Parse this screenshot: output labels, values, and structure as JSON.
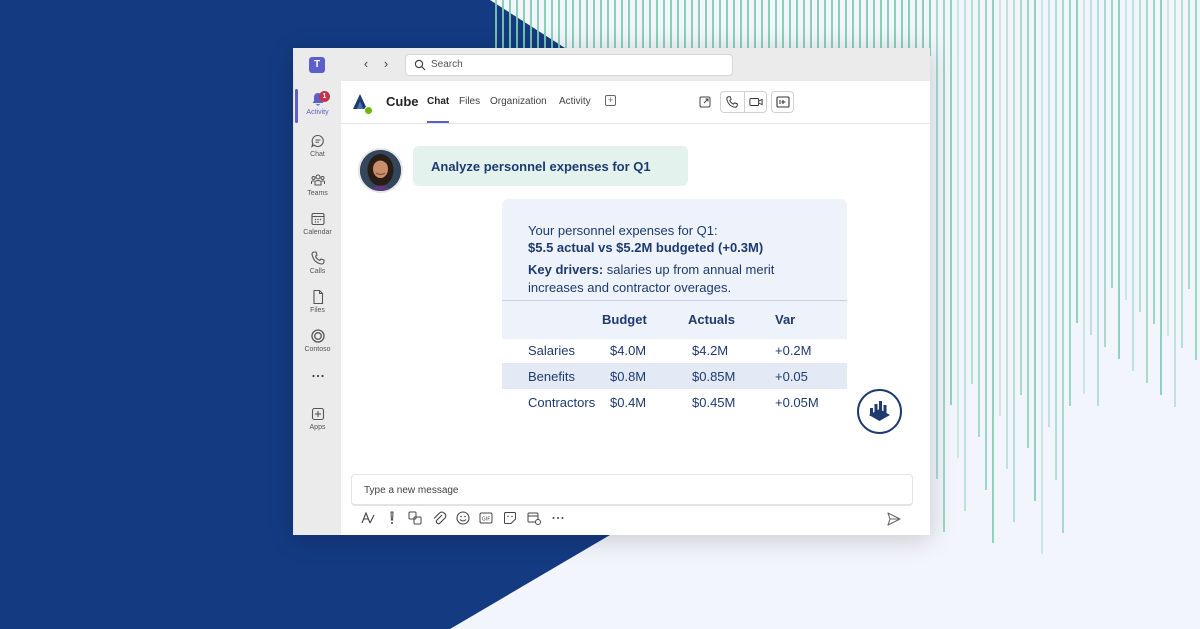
{
  "colors": {
    "navy": "#143a82",
    "stripe": "#7ccdb0",
    "teams_purple": "#5b5fc7",
    "card_text": "#1e3a70",
    "user_bubble": "#e4f2ee",
    "bot_card": "#eef2fa"
  },
  "titlebar": {
    "search_placeholder": "Search"
  },
  "rail": {
    "items": [
      {
        "label": "Activity",
        "icon": "bell-icon",
        "badge": "1"
      },
      {
        "label": "Chat",
        "icon": "chat-icon"
      },
      {
        "label": "Teams",
        "icon": "teams-icon"
      },
      {
        "label": "Calendar",
        "icon": "calendar-icon"
      },
      {
        "label": "Calls",
        "icon": "phone-icon"
      },
      {
        "label": "Files",
        "icon": "file-icon"
      },
      {
        "label": "Contoso",
        "icon": "contoso-icon"
      },
      {
        "label": "",
        "icon": "more-icon"
      },
      {
        "label": "Apps",
        "icon": "apps-icon"
      }
    ]
  },
  "header": {
    "app_name": "Cube",
    "tabs": [
      "Chat",
      "Files",
      "Organization",
      "Activity"
    ]
  },
  "conversation": {
    "user_message": "Analyze personnel expenses for Q1",
    "bot": {
      "line1": "Your personnel expenses for Q1:",
      "line2": "$5.5 actual vs $5.2M budgeted (+0.3M)",
      "drivers_label": "Key drivers:",
      "drivers_text": " salaries up from annual merit increases and contractor overages.",
      "table": {
        "headers": [
          "Budget",
          "Actuals",
          "Var"
        ],
        "rows": [
          [
            "Salaries",
            "$4.0M",
            "$4.2M",
            "+0.2M"
          ],
          [
            "Benefits",
            "$0.8M",
            "$0.85M",
            "+0.05"
          ],
          [
            "Contractors",
            "$0.4M",
            "$0.45M",
            "+0.05M"
          ]
        ]
      }
    }
  },
  "compose": {
    "placeholder": "Type a new message"
  }
}
